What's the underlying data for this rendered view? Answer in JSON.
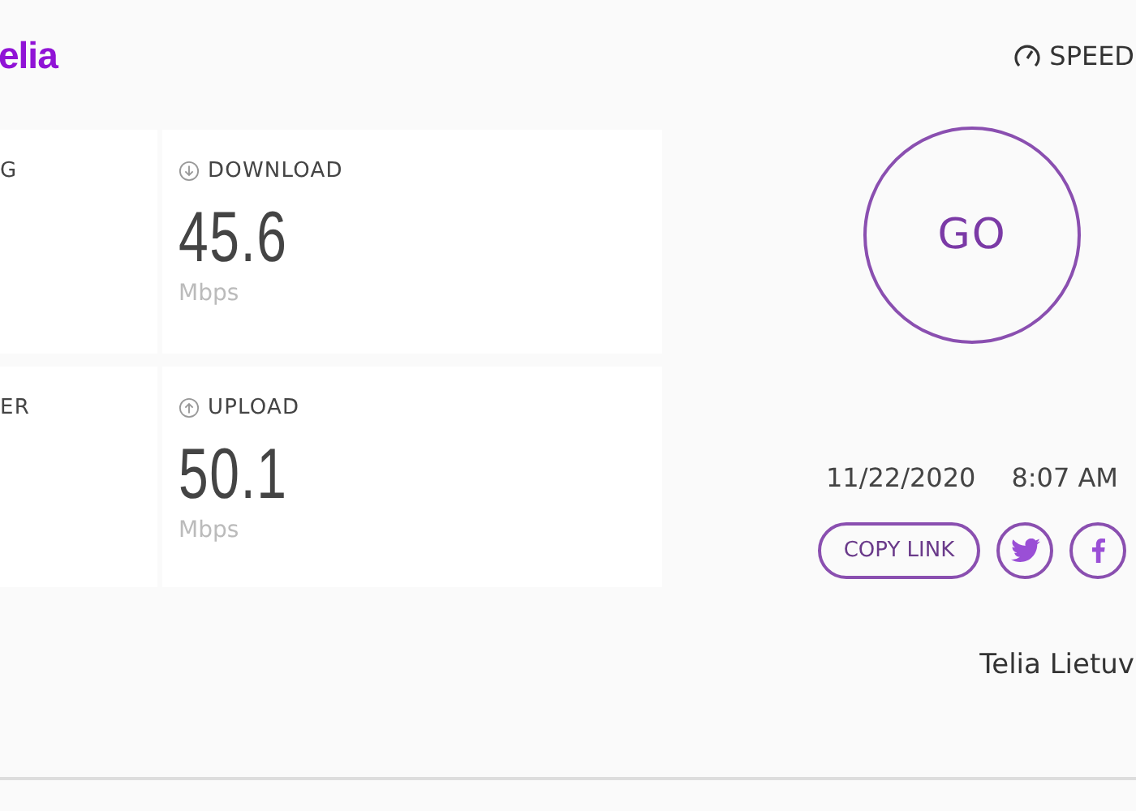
{
  "header": {
    "logo": "elia",
    "speed_link": "SPEED"
  },
  "metrics": [
    {
      "label": "G",
      "kind": "plain"
    },
    {
      "label": "DOWNLOAD",
      "kind": "down",
      "value": "45.6",
      "unit": "Mbps"
    },
    {
      "label": "ER",
      "kind": "plain"
    },
    {
      "label": "UPLOAD",
      "kind": "up",
      "value": "50.1",
      "unit": "Mbps"
    }
  ],
  "go_button": "GO",
  "date": "11/22/2020",
  "time": "8:07 AM",
  "share": {
    "copy_link": "COPY LINK"
  },
  "provider": "Telia Lietuv"
}
